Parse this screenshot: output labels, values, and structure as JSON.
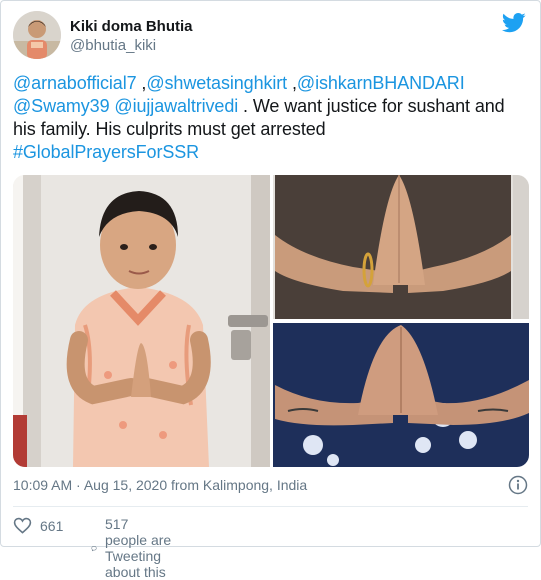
{
  "user": {
    "display_name": "Kiki doma Bhutia",
    "handle": "@bhutia_kiki"
  },
  "tweet": {
    "line1": [
      "@arnabofficial7",
      " ,",
      "@shwetasinghkirt",
      " ,",
      "@ishkarnBHANDARI"
    ],
    "line2": [
      "@Swamy39",
      " ",
      "@iujjawaltrivedi",
      " . We want justice for sushant and"
    ],
    "line3": "his family. His culprits must get arrested",
    "hashtag": "#GlobalPrayersForSSR"
  },
  "meta": {
    "timestamp": "10:09 AM · Aug 15, 2020 from Kalimpong, India"
  },
  "actions": {
    "likes": "661",
    "conversation": "517 people are Tweeting about this"
  },
  "colors": {
    "link": "#1b95e0",
    "secondary_text": "#657786",
    "twitter_blue": "#1da1f2"
  },
  "icons": [
    "twitter-bird-icon",
    "info-icon",
    "heart-icon",
    "speech-bubble-icon"
  ]
}
